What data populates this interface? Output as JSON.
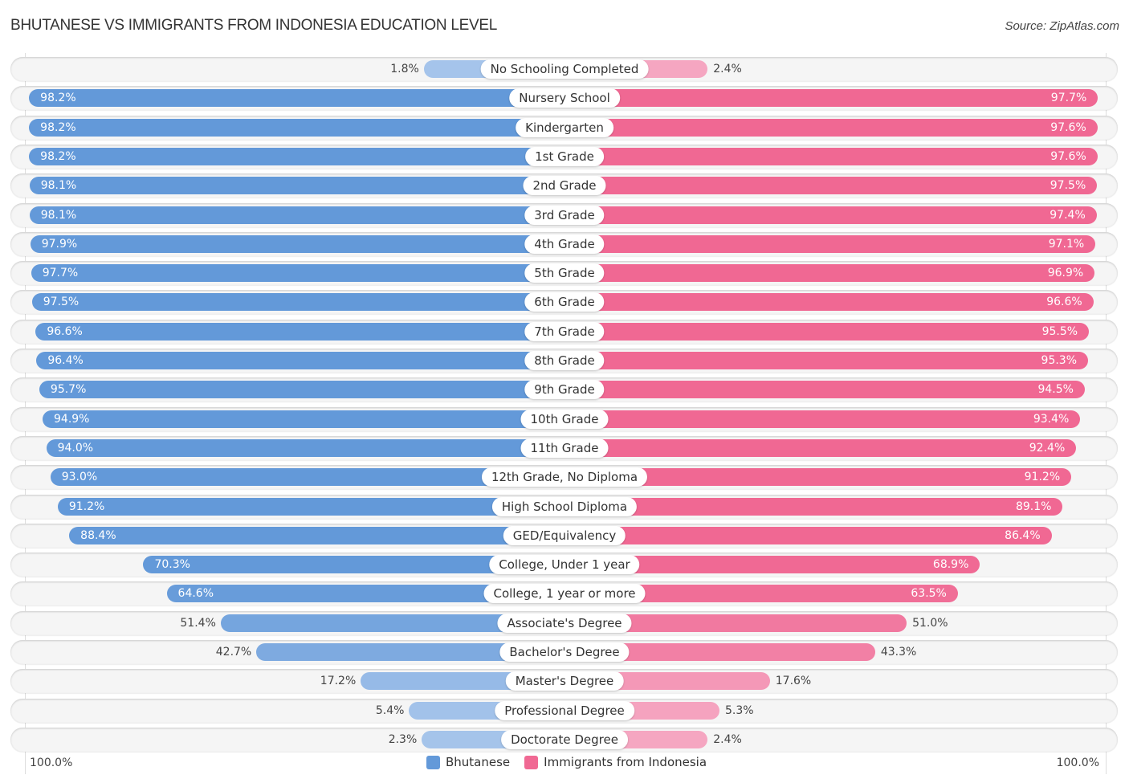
{
  "header": {
    "title": "BHUTANESE VS IMMIGRANTS FROM INDONESIA EDUCATION LEVEL",
    "source": "Source: ZipAtlas.com"
  },
  "colors": {
    "left_strong": "#6399d9",
    "left_light": "#a7c5eb",
    "right_strong": "#f06893",
    "right_light": "#f5a8c3"
  },
  "axis": {
    "left_label": "100.0%",
    "right_label": "100.0%"
  },
  "legend": [
    {
      "label": "Bhutanese",
      "color": "#6399d9"
    },
    {
      "label": "Immigrants from Indonesia",
      "color": "#f06893"
    }
  ],
  "chart_data": {
    "type": "bar",
    "orientation": "horizontal-diverging",
    "title": "BHUTANESE VS IMMIGRANTS FROM INDONESIA EDUCATION LEVEL",
    "xlim": [
      0,
      100
    ],
    "unit": "%",
    "legend_position": "bottom-center",
    "categories": [
      "No Schooling Completed",
      "Nursery School",
      "Kindergarten",
      "1st Grade",
      "2nd Grade",
      "3rd Grade",
      "4th Grade",
      "5th Grade",
      "6th Grade",
      "7th Grade",
      "8th Grade",
      "9th Grade",
      "10th Grade",
      "11th Grade",
      "12th Grade, No Diploma",
      "High School Diploma",
      "GED/Equivalency",
      "College, Under 1 year",
      "College, 1 year or more",
      "Associate's Degree",
      "Bachelor's Degree",
      "Master's Degree",
      "Professional Degree",
      "Doctorate Degree"
    ],
    "series": [
      {
        "name": "Bhutanese",
        "side": "left",
        "values": [
          1.8,
          98.2,
          98.2,
          98.2,
          98.1,
          98.1,
          97.9,
          97.7,
          97.5,
          96.6,
          96.4,
          95.7,
          94.9,
          94.0,
          93.0,
          91.2,
          88.4,
          70.3,
          64.6,
          51.4,
          42.7,
          17.2,
          5.4,
          2.3
        ],
        "labels": [
          "1.8%",
          "98.2%",
          "98.2%",
          "98.2%",
          "98.1%",
          "98.1%",
          "97.9%",
          "97.7%",
          "97.5%",
          "96.6%",
          "96.4%",
          "95.7%",
          "94.9%",
          "94.0%",
          "93.0%",
          "91.2%",
          "88.4%",
          "70.3%",
          "64.6%",
          "51.4%",
          "42.7%",
          "17.2%",
          "5.4%",
          "2.3%"
        ]
      },
      {
        "name": "Immigrants from Indonesia",
        "side": "right",
        "values": [
          2.4,
          97.7,
          97.6,
          97.6,
          97.5,
          97.4,
          97.1,
          96.9,
          96.6,
          95.5,
          95.3,
          94.5,
          93.4,
          92.4,
          91.2,
          89.1,
          86.4,
          68.9,
          63.5,
          51.0,
          43.3,
          17.6,
          5.3,
          2.4
        ],
        "labels": [
          "2.4%",
          "97.7%",
          "97.6%",
          "97.6%",
          "97.5%",
          "97.4%",
          "97.1%",
          "96.9%",
          "96.6%",
          "95.5%",
          "95.3%",
          "94.5%",
          "93.4%",
          "92.4%",
          "91.2%",
          "89.1%",
          "86.4%",
          "68.9%",
          "63.5%",
          "51.0%",
          "43.3%",
          "17.6%",
          "5.3%",
          "2.4%"
        ]
      }
    ]
  }
}
